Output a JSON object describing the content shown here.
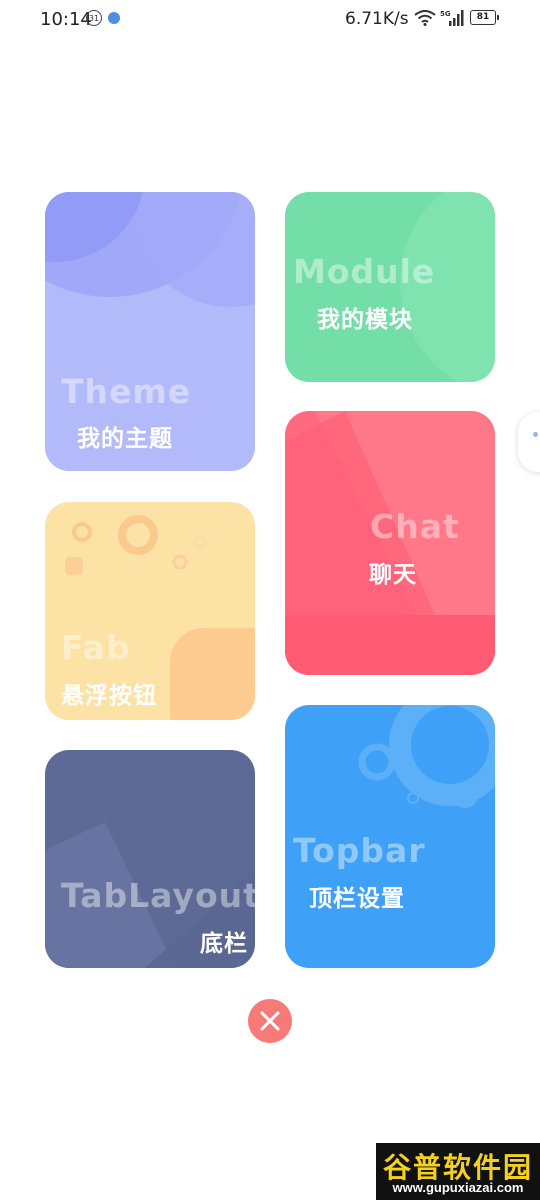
{
  "status_bar": {
    "time": "10:14",
    "notification_badge": "31",
    "net_speed": "6.71K/s",
    "network_type": "5G",
    "battery": "81"
  },
  "cards": {
    "theme": {
      "en": "Theme",
      "zh": "我的主题",
      "color": "#b3baf9"
    },
    "module": {
      "en": "Module",
      "zh": "我的模块",
      "color": "#74dea8"
    },
    "chat": {
      "en": "Chat",
      "zh": "聊天",
      "color": "#ff6a80"
    },
    "fab": {
      "en": "Fab",
      "zh": "悬浮按钮",
      "color": "#fde2a6"
    },
    "tablayout": {
      "en": "TabLayout",
      "zh": "底栏",
      "color": "#5d6a96"
    },
    "topbar": {
      "en": "Topbar",
      "zh": "顶栏设置",
      "color": "#3fa0f7"
    }
  },
  "close_button": {
    "icon": "close-icon",
    "color": "#f77a78"
  },
  "watermark": {
    "title": "谷普软件园",
    "url": "www.gupuxiazai.com"
  }
}
